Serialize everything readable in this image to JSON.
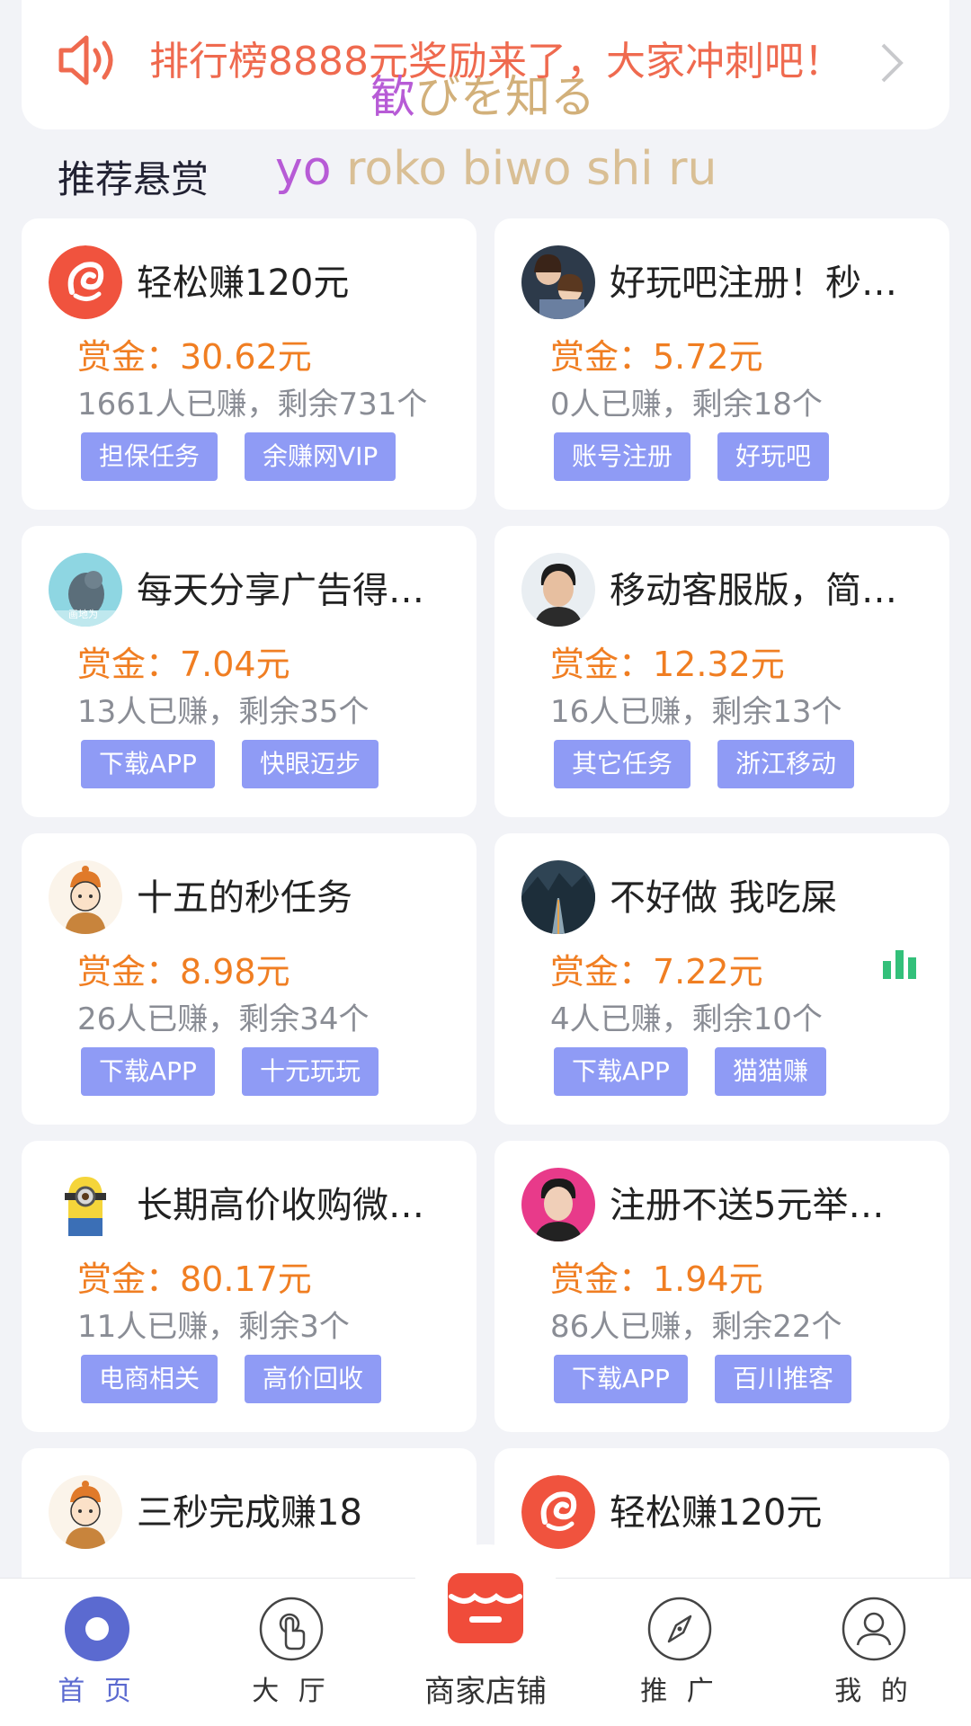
{
  "notice": {
    "text": "排行榜8888元奖励来了，大家冲刺吧！"
  },
  "overlay": {
    "jp_first": "歓",
    "jp_rest": "びを知る",
    "romaji_first": "yo",
    "romaji_rest": " roko biwo shi ru"
  },
  "section": {
    "title": "推荐悬赏"
  },
  "tasks": [
    {
      "title": "轻松赚120元",
      "reward": "赏金：30.62元",
      "stats": "1661人已赚，剩余731个",
      "tags": [
        "担保任务",
        "余赚网VIP"
      ],
      "avatar": "red-logo"
    },
    {
      "title": "好玩吧注册！秒…",
      "reward": "赏金：5.72元",
      "stats": "0人已赚，剩余18个",
      "tags": [
        "账号注册",
        "好玩吧"
      ],
      "avatar": "photo-couple"
    },
    {
      "title": "每天分享广告得…",
      "reward": "赏金：7.04元",
      "stats": "13人已赚，剩余35个",
      "tags": [
        "下载APP",
        "快眼迈步"
      ],
      "avatar": "photo-seal",
      "avatar_caption": "画地为"
    },
    {
      "title": "移动客服版，简…",
      "reward": "赏金：12.32元",
      "stats": "16人已赚，剩余13个",
      "tags": [
        "其它任务",
        "浙江移动"
      ],
      "avatar": "photo-man"
    },
    {
      "title": "十五的秒任务",
      "reward": "赏金：8.98元",
      "stats": "26人已赚，剩余34个",
      "tags": [
        "下载APP",
        "十元玩玩"
      ],
      "avatar": "cartoon-boy"
    },
    {
      "title": "不好做 我吃屎",
      "reward": "赏金：7.22元",
      "stats": "4人已赚，剩余10个",
      "tags": [
        "下载APP",
        "猫猫赚"
      ],
      "avatar": "photo-road"
    },
    {
      "title": "长期高价收购微…",
      "reward": "赏金：80.17元",
      "stats": "11人已赚，剩余3个",
      "tags": [
        "电商相关",
        "高价回收"
      ],
      "avatar": "minion"
    },
    {
      "title": "注册不送5元举…",
      "reward": "赏金：1.94元",
      "stats": "86人已赚，剩余22个",
      "tags": [
        "下载APP",
        "百川推客"
      ],
      "avatar": "photo-man-pink"
    },
    {
      "title": "三秒完成赚18",
      "reward": "",
      "stats": "",
      "tags": [],
      "avatar": "cartoon-boy"
    },
    {
      "title": "轻松赚120元",
      "reward": "",
      "stats": "",
      "tags": [],
      "avatar": "red-logo"
    }
  ],
  "nav": {
    "home": "首 页",
    "hall": "大 厅",
    "shop": "商家店铺",
    "promote": "推 广",
    "mine": "我 的"
  },
  "colors": {
    "accent": "#5b6ad0",
    "reward": "#f07e22",
    "tag": "#8f9bf5",
    "notice": "#ef6a4f"
  }
}
